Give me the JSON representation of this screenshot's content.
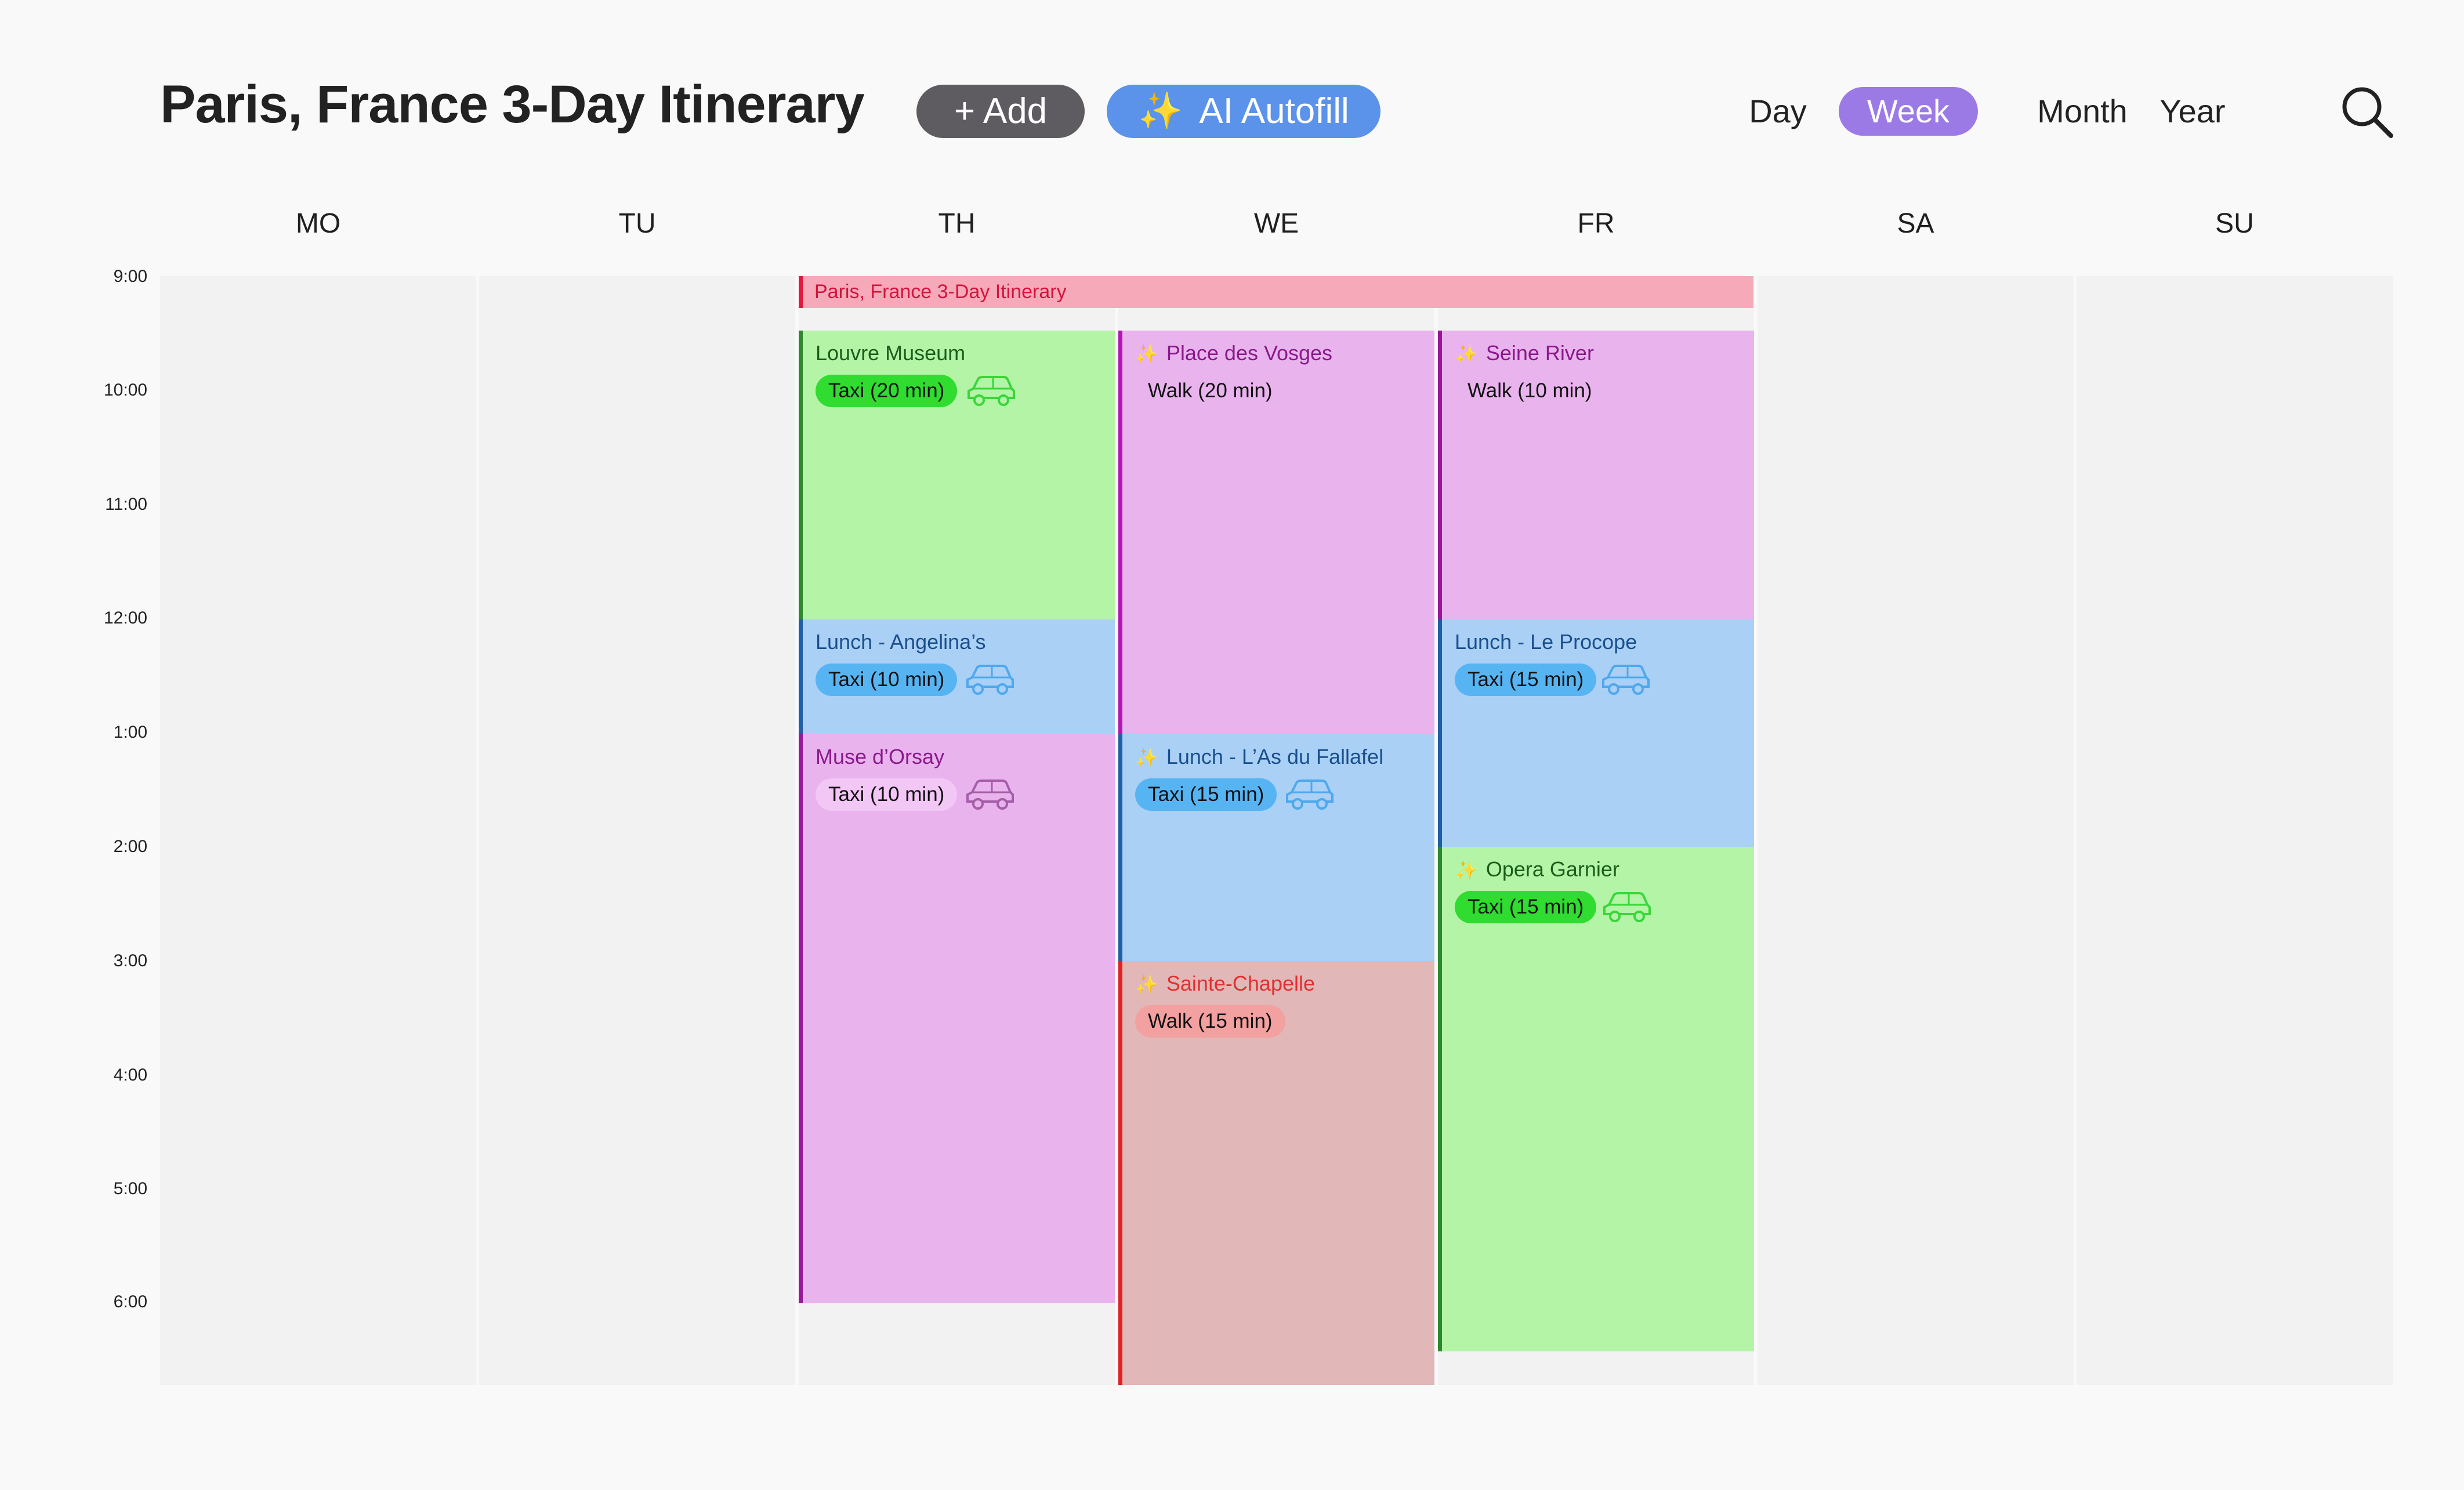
{
  "header": {
    "title": "Paris, France 3-Day Itinerary",
    "add_label": "+ Add",
    "ai_label": "AI Autofill",
    "ai_icon": "sparkles-icon",
    "views": [
      "Day",
      "Week",
      "Month",
      "Year"
    ],
    "active_view": "Week",
    "search_icon": "search-icon"
  },
  "days": [
    "MO",
    "TU",
    "TH",
    "WE",
    "FR",
    "SA",
    "SU"
  ],
  "times": [
    "9:00",
    "10:00",
    "11:00",
    "12:00",
    "1:00",
    "2:00",
    "3:00",
    "4:00",
    "5:00",
    "6:00"
  ],
  "banner": {
    "label": "Paris, France 3-Day Itinerary",
    "color": "#f6a9b9"
  },
  "events": {
    "louvre": {
      "title": "Louvre Museum",
      "transport": "Taxi (20 min)",
      "color": "#b4f4a7"
    },
    "angelinas": {
      "title": "Lunch - Angelina’s",
      "transport": "Taxi (10 min)",
      "color": "#aad0f5"
    },
    "orsay": {
      "title": "Muse d’Orsay",
      "transport": "Taxi (10 min)",
      "color": "#e9b3ee"
    },
    "vosges": {
      "title": "Place des Vosges",
      "transport": "Walk (20 min)",
      "ai": true,
      "color": "#e9b3ee"
    },
    "fallafel": {
      "title": "Lunch - L’As du Fallafel",
      "transport": "Taxi (15 min)",
      "ai": true,
      "color": "#aad0f5"
    },
    "chapelle": {
      "title": "Sainte-Chapelle",
      "transport": "Walk (15 min)",
      "ai": true,
      "color": "#e1b7b7"
    },
    "seine": {
      "title": "Seine River",
      "transport": "Walk (10 min)",
      "ai": true,
      "color": "#e9b3ee"
    },
    "procope": {
      "title": "Lunch - Le Procope",
      "transport": "Taxi (15 min)",
      "color": "#aad0f5"
    },
    "garnier": {
      "title": "Opera Garnier",
      "transport": "Taxi (15 min)",
      "ai": true,
      "color": "#b4f4a7"
    }
  }
}
